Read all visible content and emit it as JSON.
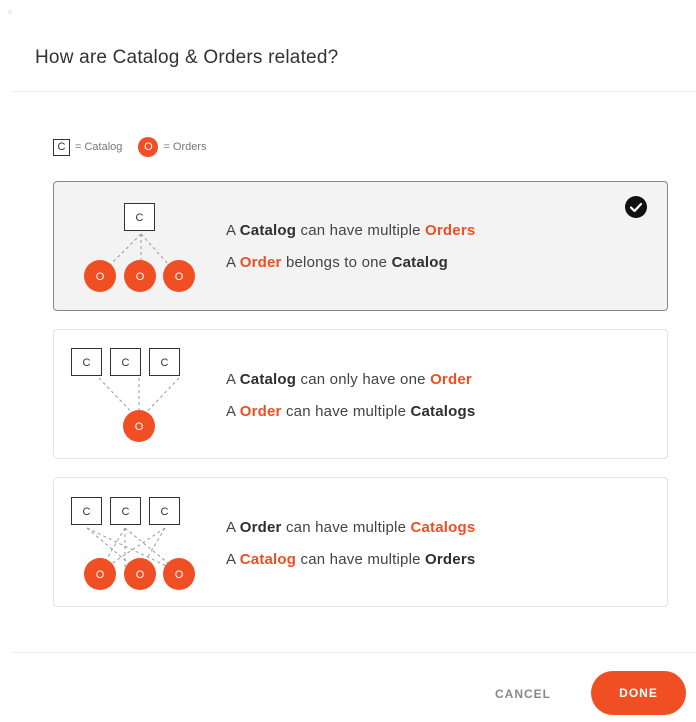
{
  "dialog": {
    "title": "How are Catalog & Orders related?"
  },
  "legend": {
    "catalog_symbol": "C",
    "catalog_label": "= Catalog",
    "order_symbol": "O",
    "order_label": "= Orders"
  },
  "colors": {
    "accent": "#f04e23",
    "selected_background": "#f3f3f3",
    "text": "#333333"
  },
  "diagram_symbols": {
    "catalog": "C",
    "order": "O"
  },
  "options": [
    {
      "relation": "one-to-many",
      "selected": true,
      "line1": {
        "pre": "A ",
        "b1": "Catalog",
        "mid": " can have multiple ",
        "b2": "Orders"
      },
      "line2": {
        "pre": "A ",
        "b1": "Order",
        "mid": " belongs to one ",
        "b2": "Catalog"
      }
    },
    {
      "relation": "many-to-one",
      "selected": false,
      "line1": {
        "pre": "A ",
        "b1": "Catalog",
        "mid": " can only have one ",
        "b2": "Order"
      },
      "line2": {
        "pre": "A ",
        "b1": "Order",
        "mid": " can have multiple ",
        "b2": "Catalogs"
      }
    },
    {
      "relation": "many-to-many",
      "selected": false,
      "line1": {
        "pre": "A ",
        "b1": "Order",
        "mid": " can have multiple ",
        "b2": "Catalogs"
      },
      "line2": {
        "pre": "A ",
        "b1": "Catalog",
        "mid": " can have multiple ",
        "b2": "Orders"
      }
    }
  ],
  "selected_icon": "check-circle-icon",
  "footer": {
    "cancel_label": "CANCEL",
    "done_label": "DONE"
  }
}
